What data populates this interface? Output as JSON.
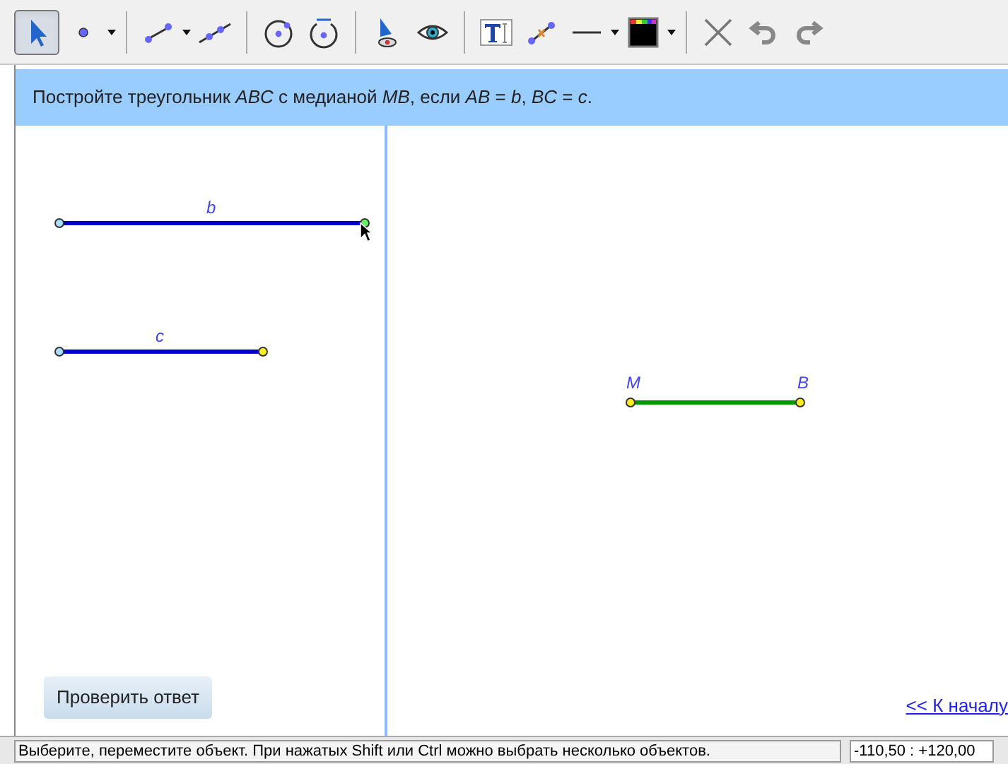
{
  "toolbar": {
    "groups": [
      [
        {
          "kind": "move",
          "selected": true
        },
        {
          "kind": "point",
          "selected": false,
          "dropdown": true
        }
      ],
      [
        {
          "kind": "segment",
          "selected": false,
          "dropdown": true
        },
        {
          "kind": "line",
          "selected": false
        }
      ],
      [
        {
          "kind": "circle",
          "selected": false
        },
        {
          "kind": "compass",
          "selected": false
        }
      ],
      [
        {
          "kind": "show-hide",
          "selected": false
        },
        {
          "kind": "eye",
          "selected": false
        }
      ],
      [
        {
          "kind": "text",
          "selected": false
        },
        {
          "kind": "midpoint",
          "selected": false
        },
        {
          "kind": "line-style",
          "selected": false,
          "dropdown": true
        },
        {
          "kind": "color",
          "selected": false,
          "dropdown": true
        }
      ],
      [
        {
          "kind": "delete",
          "selected": false
        },
        {
          "kind": "undo",
          "selected": false
        },
        {
          "kind": "redo",
          "selected": false
        }
      ]
    ]
  },
  "task": "Постройте треугольник *ABC* с медианой *MB*, если *AB* = *b*, *BC* = *c*.",
  "left_panel": {
    "segments": [
      {
        "label": "b",
        "color": "#0000cc"
      },
      {
        "label": "c",
        "color": "#0000cc"
      }
    ],
    "check_button": "Проверить ответ"
  },
  "right_panel": {
    "segment": {
      "color": "#009900",
      "start_label": "M",
      "end_label": "B"
    },
    "link": "<< К началу"
  },
  "status_bar": {
    "hint": "Выберите, переместите объект. При нажатых Shift или Ctrl можно выбрать несколько объектов.",
    "coordinates": "-110,50 : +120,00"
  }
}
